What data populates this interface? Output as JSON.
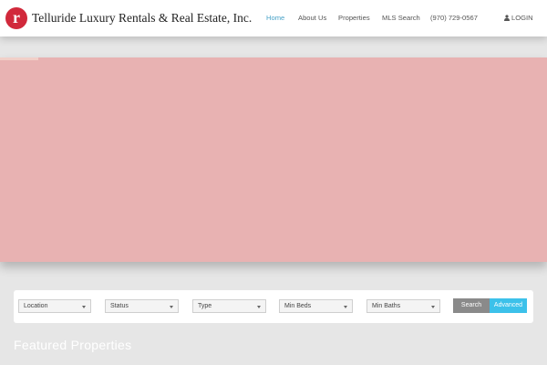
{
  "header": {
    "brand": "Telluride Luxury Rentals & Real Estate, Inc.",
    "logo_letter": "r",
    "nav": [
      {
        "label": "Home",
        "active": true
      },
      {
        "label": "About Us"
      },
      {
        "label": "Properties"
      },
      {
        "label": "MLS Search"
      },
      {
        "label": "(970) 729-0567"
      }
    ],
    "login_label": "LOGIN"
  },
  "search": {
    "fields": [
      {
        "label": "Location"
      },
      {
        "label": "Status"
      },
      {
        "label": "Type"
      },
      {
        "label": "Min Beds"
      },
      {
        "label": "Min Baths"
      }
    ],
    "search_label": "Search",
    "advanced_label": "Advanced"
  },
  "featured": {
    "title": "Featured Properties"
  },
  "colors": {
    "accent": "#4aa3c8",
    "logo": "#d1293b",
    "hero": "#e8b2b2",
    "advanced": "#3cc1ea"
  },
  "icons": {
    "login": "user-icon",
    "select": "chevron-down-icon"
  }
}
